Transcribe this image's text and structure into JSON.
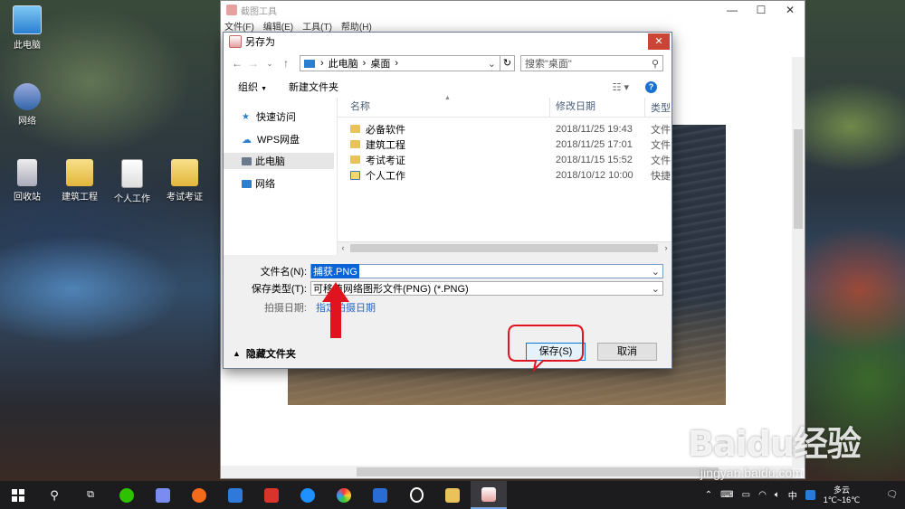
{
  "desktop": {
    "icons": [
      {
        "label": "此电脑",
        "icon": "pc-icon"
      },
      {
        "label": "网络",
        "icon": "network-icon"
      },
      {
        "label": "回收站",
        "icon": "recycle-bin-icon"
      },
      {
        "label": "建筑工程",
        "icon": "folder-icon"
      },
      {
        "label": "个人工作",
        "icon": "document-icon"
      },
      {
        "label": "考试考证",
        "icon": "folder-icon"
      }
    ]
  },
  "snip_window": {
    "title": "截图工具",
    "menu": [
      "文件(F)",
      "编辑(E)",
      "工具(T)",
      "帮助(H)"
    ]
  },
  "dialog": {
    "title": "另存为",
    "address": {
      "segments": [
        "此电脑",
        "桌面"
      ]
    },
    "search_placeholder": "搜索\"桌面\"",
    "toolbar": {
      "organize": "组织",
      "new_folder": "新建文件夹"
    },
    "nav": [
      {
        "label": "快速访问",
        "icon": "star-icon"
      },
      {
        "label": "WPS网盘",
        "icon": "cloud-icon"
      },
      {
        "label": "此电脑",
        "icon": "pc-icon"
      },
      {
        "label": "网络",
        "icon": "network-icon"
      }
    ],
    "columns": {
      "name": "名称",
      "modified": "修改日期",
      "type": "类型"
    },
    "files": [
      {
        "name": "必备软件",
        "modified": "2018/11/25 19:43",
        "type": "文件"
      },
      {
        "name": "建筑工程",
        "modified": "2018/11/25 17:01",
        "type": "文件"
      },
      {
        "name": "考试考证",
        "modified": "2018/11/15 15:52",
        "type": "文件"
      },
      {
        "name": "个人工作",
        "modified": "2018/10/12 10:00",
        "type": "快捷"
      }
    ],
    "filename_label": "文件名(N):",
    "filename_value": "捕获.PNG",
    "filetype_label": "保存类型(T):",
    "filetype_value": "可移植网络图形文件(PNG) (*.PNG)",
    "date_label": "拍摄日期:",
    "date_link": "指定拍摄日期",
    "hide_folders": "隐藏文件夹",
    "save_button": "保存(S)",
    "cancel_button": "取消"
  },
  "taskbar": {
    "ime": "中",
    "weather_text": "多云",
    "temperature": "1℃~16℃"
  },
  "watermark": {
    "brand": "Baidu经验",
    "url": "jingyan.baidu.com"
  },
  "colors": {
    "accent": "#0078d7",
    "selection": "#0a64d8",
    "annotation_red": "#e0141e"
  }
}
